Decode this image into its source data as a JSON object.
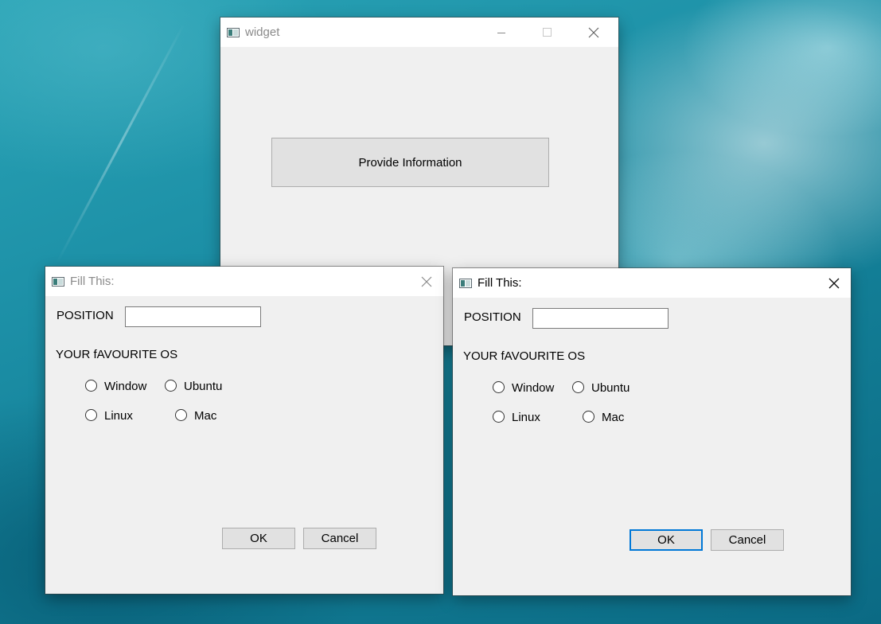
{
  "main_window": {
    "title": "widget",
    "provide_button_label": "Provide Information"
  },
  "dialog_left": {
    "title": "Fill This:",
    "position_label": "POSITION",
    "position_value": "",
    "os_heading": "YOUR fAVOURITE OS",
    "options": [
      "Window",
      "Ubuntu",
      "Linux",
      "Mac"
    ],
    "ok_label": "OK",
    "cancel_label": "Cancel",
    "focused": false
  },
  "dialog_right": {
    "title": "Fill This:",
    "position_label": "POSITION",
    "position_value": "",
    "os_heading": "YOUR fAVOURITE OS",
    "options": [
      "Window",
      "Ubuntu",
      "Linux",
      "Mac"
    ],
    "ok_label": "OK",
    "cancel_label": "Cancel",
    "focused": true
  },
  "colors": {
    "window_bg": "#f0f0f0",
    "default_button_border": "#0078d7",
    "inactive_title": "#8a8a8a"
  }
}
